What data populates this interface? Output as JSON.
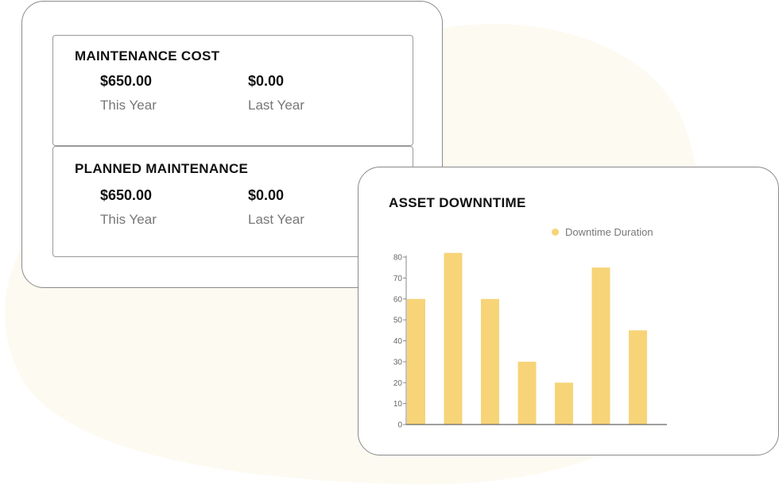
{
  "colors": {
    "accent": "#f7d478",
    "blob": "#fdfaf1"
  },
  "cards": [
    {
      "title": "MAINTENANCE COST",
      "current_value": "$650.00",
      "current_label": "This Year",
      "previous_value": "$0.00",
      "previous_label": "Last Year"
    },
    {
      "title": "PLANNED MAINTENANCE",
      "current_value": "$650.00",
      "current_label": "This Year",
      "previous_value": "$0.00",
      "previous_label": "Last Year"
    }
  ],
  "chart_data": {
    "type": "bar",
    "title": "ASSET DOWNNTIME",
    "xlabel": "",
    "ylabel": "",
    "ylim": [
      0,
      80
    ],
    "yticks": [
      "0",
      "10",
      "20",
      "30",
      "40",
      "50",
      "60",
      "70",
      "80"
    ],
    "series": [
      {
        "name": "Downtime Duration",
        "color": "#f7d478",
        "values": [
          60,
          82,
          60,
          30,
          20,
          75,
          45
        ]
      }
    ],
    "legend": "top-right",
    "grid": false
  }
}
